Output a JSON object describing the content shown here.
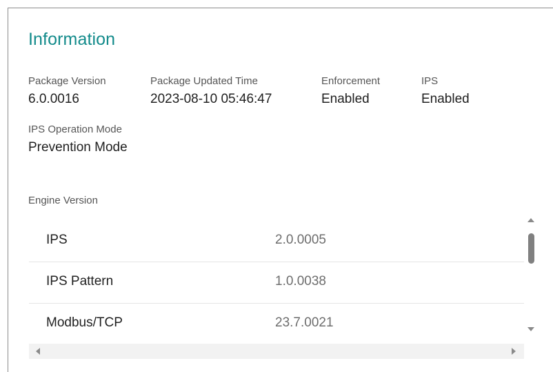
{
  "section_title": "Information",
  "info": {
    "package_version": {
      "label": "Package Version",
      "value": "6.0.0016"
    },
    "package_updated_time": {
      "label": "Package Updated Time",
      "value": "2023-08-10 05:46:47"
    },
    "enforcement": {
      "label": "Enforcement",
      "value": "Enabled"
    },
    "ips": {
      "label": "IPS",
      "value": "Enabled"
    },
    "ips_operation_mode": {
      "label": "IPS Operation Mode",
      "value": "Prevention Mode"
    }
  },
  "engine_version": {
    "label": "Engine Version",
    "rows": [
      {
        "name": "IPS",
        "version": "2.0.0005"
      },
      {
        "name": "IPS Pattern",
        "version": "1.0.0038"
      },
      {
        "name": "Modbus/TCP",
        "version": "23.7.0021"
      }
    ]
  },
  "colors": {
    "accent": "#138b8b",
    "text": "#1f1f1f",
    "muted": "#555555"
  }
}
